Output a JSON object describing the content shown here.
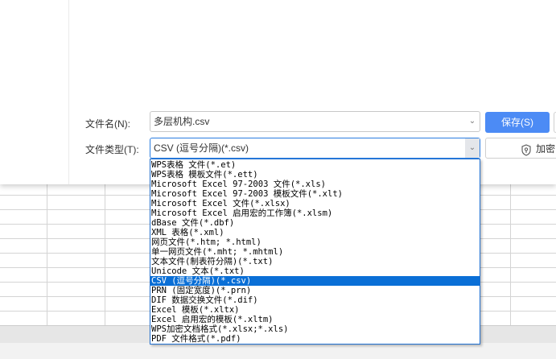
{
  "dialog": {
    "filename_label": "文件名(N):",
    "filename_value": "多层机构.csv",
    "filetype_label": "文件类型(T):",
    "filetype_value": "CSV (逗号分隔)(*.csv)",
    "save_label": "保存(S)",
    "encrypt_label": "加密",
    "selected_index": 12,
    "filetype_options": [
      "WPS表格 文件(*.et)",
      "WPS表格 模板文件(*.ett)",
      "Microsoft Excel 97-2003 文件(*.xls)",
      "Microsoft Excel 97-2003 模板文件(*.xlt)",
      "Microsoft Excel 文件(*.xlsx)",
      "Microsoft Excel 启用宏的工作簿(*.xlsm)",
      "dBase 文件(*.dbf)",
      "XML 表格(*.xml)",
      "网页文件(*.htm; *.html)",
      "单一网页文件(*.mht; *.mhtml)",
      "文本文件(制表符分隔)(*.txt)",
      "Unicode 文本(*.txt)",
      "CSV (逗号分隔)(*.csv)",
      "PRN (固定宽度)(*.prn)",
      "DIF 数据交换文件(*.dif)",
      "Excel 模板(*.xltx)",
      "Excel 启用宏的模板(*.xltm)",
      "WPS加密文档格式(*.xlsx;*.xls)",
      "PDF 文件格式(*.pdf)"
    ]
  }
}
